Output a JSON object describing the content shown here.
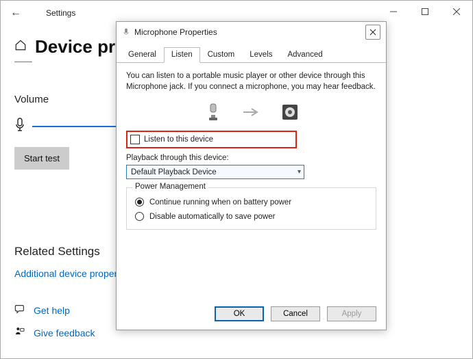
{
  "settings": {
    "window_title": "Settings",
    "page_title": "Device properties",
    "volume_label": "Volume",
    "start_test": "Start test",
    "related_heading": "Related Settings",
    "related_link": "Additional device properties",
    "get_help": "Get help",
    "give_feedback": "Give feedback"
  },
  "dialog": {
    "title": "Microphone Properties",
    "tabs": {
      "general": "General",
      "listen": "Listen",
      "custom": "Custom",
      "levels": "Levels",
      "advanced": "Advanced"
    },
    "description": "You can listen to a portable music player or other device through this Microphone jack.  If you connect a microphone, you may hear feedback.",
    "listen_checkbox": "Listen to this device",
    "listen_checked": false,
    "playback_label": "Playback through this device:",
    "playback_selected": "Default Playback Device",
    "power_mgmt": {
      "legend": "Power Management",
      "continue": "Continue running when on battery power",
      "disable": "Disable automatically to save power",
      "selected": "continue"
    },
    "buttons": {
      "ok": "OK",
      "cancel": "Cancel",
      "apply": "Apply"
    }
  }
}
